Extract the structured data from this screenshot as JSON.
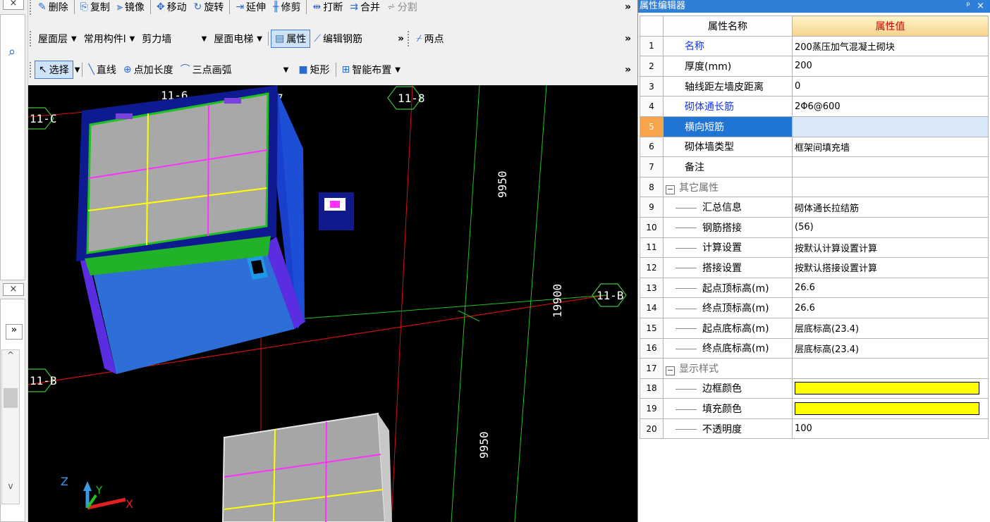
{
  "left_panel": {
    "top_close_icon": "×",
    "search_icon": "⌕",
    "mid_close_icon": "×",
    "expand_icon": "»",
    "scroll_up_icon": "^",
    "scroll_down_icon": "v"
  },
  "toolbar1": {
    "items": [
      "删除",
      "复制",
      "镜像",
      "移动",
      "旋转",
      "延伸",
      "修剪",
      "打断",
      "合并",
      "分割"
    ],
    "more": "»"
  },
  "toolbar2": {
    "floor": "屋面层",
    "component_type": "常用构件l",
    "component_name": "剪力墙",
    "instance": "屋面电梯",
    "properties": "属性",
    "edit_rebar": "编辑钢筋",
    "more1": "»",
    "two_point": "两点",
    "more2": "»"
  },
  "toolbar3": {
    "select": "选择",
    "line": "直线",
    "point_length": "点加长度",
    "three_point_arc": "三点画弧",
    "rectangle": "矩形",
    "smart_layout": "智能布置",
    "more": "»"
  },
  "viewport": {
    "axis_labels": [
      "11-C",
      "11-6",
      "7",
      "11-8",
      "11-B",
      "11-B"
    ],
    "dims": [
      "9950",
      "19900",
      "9950"
    ],
    "coord": {
      "z": "Z",
      "y": "Y",
      "x": "X"
    }
  },
  "property_editor": {
    "title": "属性编辑器",
    "pin_icon": "ᵖ",
    "close_icon": "×",
    "header_name": "属性名称",
    "header_value": "属性值",
    "rows": [
      {
        "num": "1",
        "name": "名称",
        "value": "200蒸压加气混凝土砌块"
      },
      {
        "num": "2",
        "name": "厚度(mm)",
        "value": "200"
      },
      {
        "num": "3",
        "name": "轴线距左墙皮距离",
        "value": "0"
      },
      {
        "num": "4",
        "name": "砌体通长筋",
        "value": "2Φ6@600"
      },
      {
        "num": "5",
        "name": "横向短筋",
        "value": ""
      },
      {
        "num": "6",
        "name": "砌体墙类型",
        "value": "框架间填充墙"
      },
      {
        "num": "7",
        "name": "备注",
        "value": ""
      },
      {
        "num": "8",
        "name": "其它属性",
        "value": ""
      },
      {
        "num": "9",
        "name": "汇总信息",
        "value": "砌体通长拉结筋"
      },
      {
        "num": "10",
        "name": "钢筋搭接",
        "value": "(56)"
      },
      {
        "num": "11",
        "name": "计算设置",
        "value": "按默认计算设置计算"
      },
      {
        "num": "12",
        "name": "搭接设置",
        "value": "按默认搭接设置计算"
      },
      {
        "num": "13",
        "name": "起点顶标高(m)",
        "value": "26.6"
      },
      {
        "num": "14",
        "name": "终点顶标高(m)",
        "value": "26.6"
      },
      {
        "num": "15",
        "name": "起点底标高(m)",
        "value": "层底标高(23.4)"
      },
      {
        "num": "16",
        "name": "终点底标高(m)",
        "value": "层底标高(23.4)"
      },
      {
        "num": "17",
        "name": "显示样式",
        "value": ""
      },
      {
        "num": "18",
        "name": "边框颜色",
        "value": ""
      },
      {
        "num": "19",
        "name": "填充颜色",
        "value": ""
      },
      {
        "num": "20",
        "name": "不透明度",
        "value": "100"
      }
    ],
    "group_toggle": "−",
    "swatch_color": "#ffff00"
  }
}
